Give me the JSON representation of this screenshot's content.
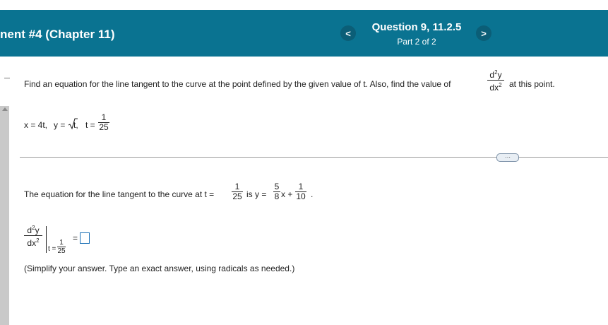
{
  "header": {
    "assignment_title": "nent #4 (Chapter 11)",
    "question_title": "Question 9, 11.2.5",
    "question_part": "Part 2 of 2",
    "prev_label": "<",
    "next_label": ">"
  },
  "question": {
    "prompt_before": "Find an equation for the line tangent to the curve at the point defined by the given value of t. Also, find the value of",
    "prompt_after": "at this point.",
    "d2y": "d y",
    "dx2": "dx",
    "exp": "2",
    "given_x": "x = 4t,",
    "given_y": "y =",
    "given_y_rad": "t,",
    "given_t": "t =",
    "t_num": "1",
    "t_den": "25"
  },
  "more_label": "···",
  "part1": {
    "prefix": "The equation for the line tangent to the curve at t =",
    "t_num": "1",
    "t_den": "25",
    "is_y": "is y =",
    "slope_num": "5",
    "slope_den": "8",
    "x_plus": "x +",
    "int_num": "1",
    "int_den": "10",
    "period": "."
  },
  "part2": {
    "eval_t": "t =",
    "eval_num": "1",
    "eval_den": "25",
    "equals": "=",
    "hint": "(Simplify your answer. Type an exact answer, using radicals as needed.)"
  }
}
